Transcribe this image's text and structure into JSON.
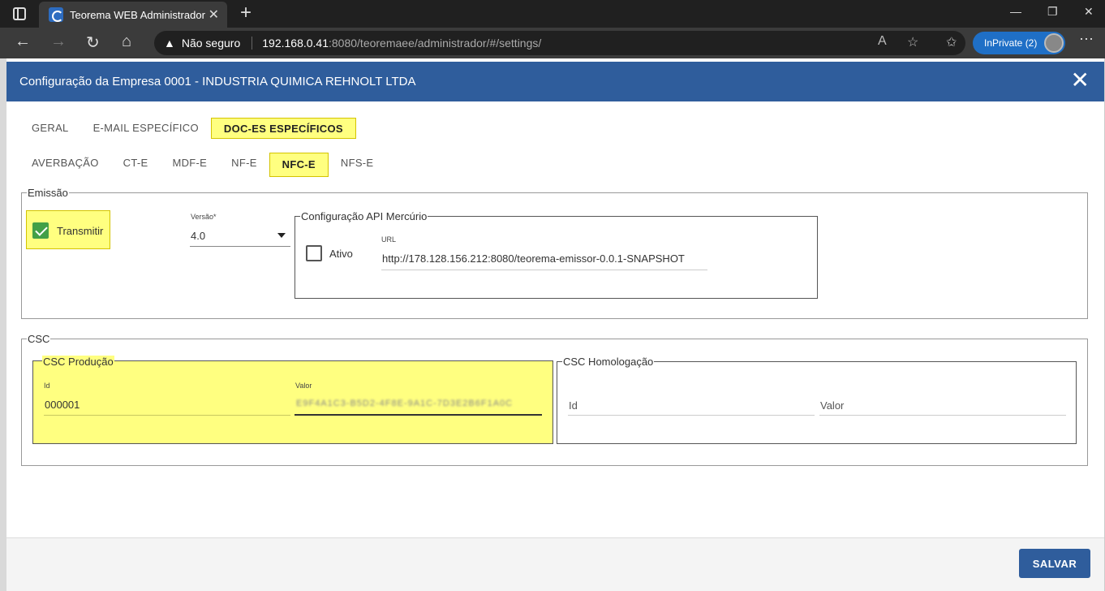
{
  "browser": {
    "tab_title": "Teorema WEB Administrador",
    "security_text": "Não seguro",
    "url_host": "192.168.0.41",
    "url_path": ":8080/teoremaee/administrador/#/settings/",
    "inprivate_label": "InPrivate (2)"
  },
  "dialog": {
    "title": "Configuração da Empresa 0001 - INDUSTRIA QUIMICA REHNOLT LTDA",
    "close_glyph": "✕"
  },
  "main_tabs": [
    {
      "label": "GERAL"
    },
    {
      "label": "E-MAIL ESPECÍFICO"
    },
    {
      "label": "DOC-ES ESPECÍFICOS"
    }
  ],
  "doc_tabs": [
    {
      "label": "AVERBAÇÃO"
    },
    {
      "label": "CT-E"
    },
    {
      "label": "MDF-E"
    },
    {
      "label": "NF-E"
    },
    {
      "label": "NFC-E"
    },
    {
      "label": "NFS-E"
    }
  ],
  "emissao": {
    "legend": "Emissão",
    "transmitir_label": "Transmitir",
    "transmitir_checked": true,
    "versao_label": "Versão*",
    "versao_value": "4.0",
    "api": {
      "legend": "Configuração API Mercúrio",
      "ativo_label": "Ativo",
      "ativo_checked": false,
      "url_label": "URL",
      "url_value": "http://178.128.156.212:8080/teorema-emissor-0.0.1-SNAPSHOT"
    }
  },
  "csc": {
    "legend": "CSC",
    "producao": {
      "legend": "CSC Produção",
      "id_label": "Id",
      "id_value": "000001",
      "valor_label": "Valor",
      "valor_value": "E9F4A1C3-B5D2-4F8E-9A1C-7D3E2B6F1A0C"
    },
    "homologacao": {
      "legend": "CSC Homologação",
      "id_placeholder": "Id",
      "valor_placeholder": "Valor"
    }
  },
  "footer": {
    "save_label": "SALVAR"
  },
  "colors": {
    "header_blue": "#2f5d9c",
    "highlight_yellow": "#ffff80",
    "check_green": "#43a047"
  }
}
